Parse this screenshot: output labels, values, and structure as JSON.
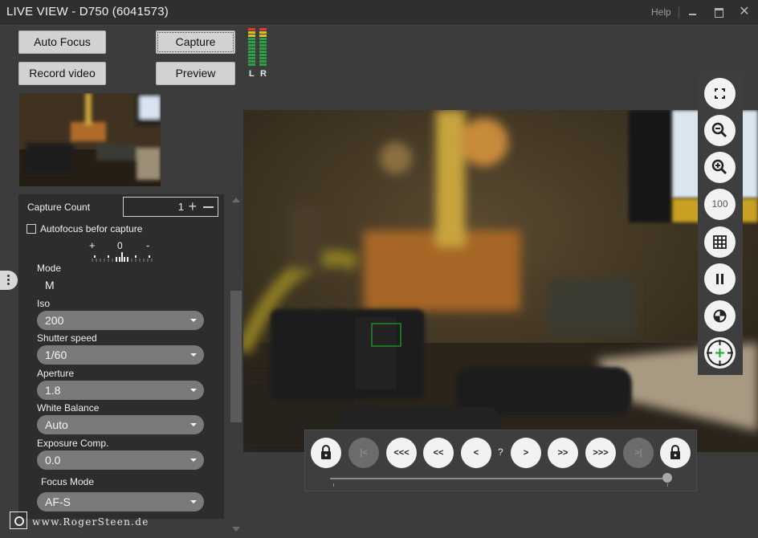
{
  "window": {
    "title": "LIVE VIEW - D750 (6041573)",
    "help_label": "Help"
  },
  "toolbar": {
    "auto_focus": "Auto Focus",
    "capture": "Capture",
    "record_video": "Record video",
    "preview": "Preview"
  },
  "audio_meter": {
    "left_label": "L",
    "right_label": "R",
    "left_level": 1.0,
    "right_level": 1.0
  },
  "settings": {
    "capture_count_label": "Capture Count",
    "capture_count_value": "1",
    "autofocus_before_capture_label": "Autofocus befor capture",
    "autofocus_before_capture_checked": false,
    "exposure_indicator": {
      "plus": "+",
      "zero": "0",
      "minus": "-"
    },
    "mode_label": "Mode",
    "mode_value": "M",
    "iso_label": "Iso",
    "iso_value": "200",
    "shutter_label": "Shutter speed",
    "shutter_value": "1/60",
    "aperture_label": "Aperture",
    "aperture_value": "1.8",
    "white_balance_label": "White Balance",
    "white_balance_value": "Auto",
    "exposure_comp_label": "Exposure Comp.",
    "exposure_comp_value": "0.0",
    "focus_mode_label": "Focus Mode",
    "focus_mode_value": "AF-S"
  },
  "live_toolbar": {
    "zoom_100_label": "100"
  },
  "navigation": {
    "first": "|<",
    "back_3": "<<<",
    "back_2": "<<",
    "back_1": "<",
    "position": "?",
    "forward_1": ">",
    "forward_2": ">>",
    "forward_3": ">>>",
    "last": ">|",
    "slider_position": 1.0
  },
  "brand": {
    "text": "www.RogerSteen.de"
  },
  "colors": {
    "background": "#3c3c3c",
    "panel": "#2d2d2d",
    "button_face": "#d2d2d2",
    "select_face": "#7a7a7a",
    "meter_green": "#2ea043",
    "meter_yellow": "#d4c020",
    "meter_red": "#e03a2a",
    "focus_box": "#1aa82a"
  }
}
